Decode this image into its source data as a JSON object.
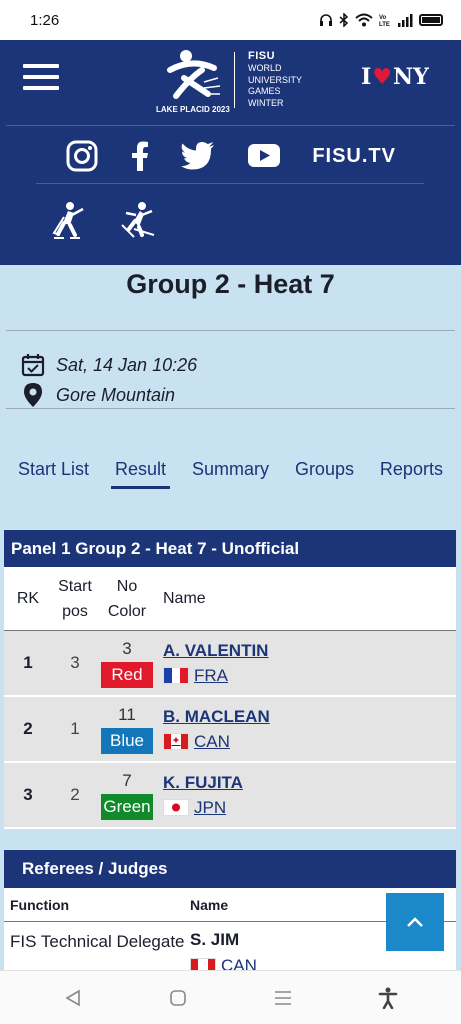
{
  "status_bar": {
    "time": "1:26"
  },
  "header": {
    "logo": {
      "brand": "FISU",
      "event": [
        "WORLD",
        "UNIVERSITY",
        "GAMES",
        "WINTER"
      ],
      "location": "LAKE PLACID 2023"
    },
    "i_love_ny": {
      "i": "I",
      "ny": "NY"
    },
    "socials": {
      "tv_label": "FISU.TV"
    }
  },
  "event": {
    "title": "Group 2 - Heat 7",
    "date": "Sat, 14 Jan 10:26",
    "venue": "Gore Mountain"
  },
  "tabs": [
    {
      "label": "Start List",
      "active": false
    },
    {
      "label": "Result",
      "active": true
    },
    {
      "label": "Summary",
      "active": false
    },
    {
      "label": "Groups",
      "active": false
    },
    {
      "label": "Reports",
      "active": false
    }
  ],
  "results": {
    "heading": "Panel 1 Group 2 - Heat 7  -  Unofficial",
    "columns": {
      "rk": "RK",
      "start_pos_1": "Start",
      "start_pos_2": "pos",
      "no_color_1": "No",
      "no_color_2": "Color",
      "name": "Name"
    },
    "rows": [
      {
        "rk": "1",
        "start_pos": "3",
        "bib": "3",
        "color_label": "Red",
        "color_hex": "#e01a2b",
        "name": "A. VALENTIN",
        "nation": "FRA"
      },
      {
        "rk": "2",
        "start_pos": "1",
        "bib": "11",
        "color_label": "Blue",
        "color_hex": "#1276b8",
        "name": "B. MACLEAN",
        "nation": "CAN"
      },
      {
        "rk": "3",
        "start_pos": "2",
        "bib": "7",
        "color_label": "Green",
        "color_hex": "#108a2a",
        "name": "K. FUJITA",
        "nation": "JPN"
      }
    ]
  },
  "referees": {
    "heading": "Referees / Judges",
    "columns": {
      "function": "Function",
      "name": "Name"
    },
    "rows": [
      {
        "function": "FIS Technical Delegate",
        "name": "S. JIM",
        "nation": "CAN"
      }
    ]
  },
  "colors": {
    "header_bg": "#1c3478",
    "page_bg": "#c9e2f1",
    "totop_bg": "#1a88c9"
  }
}
